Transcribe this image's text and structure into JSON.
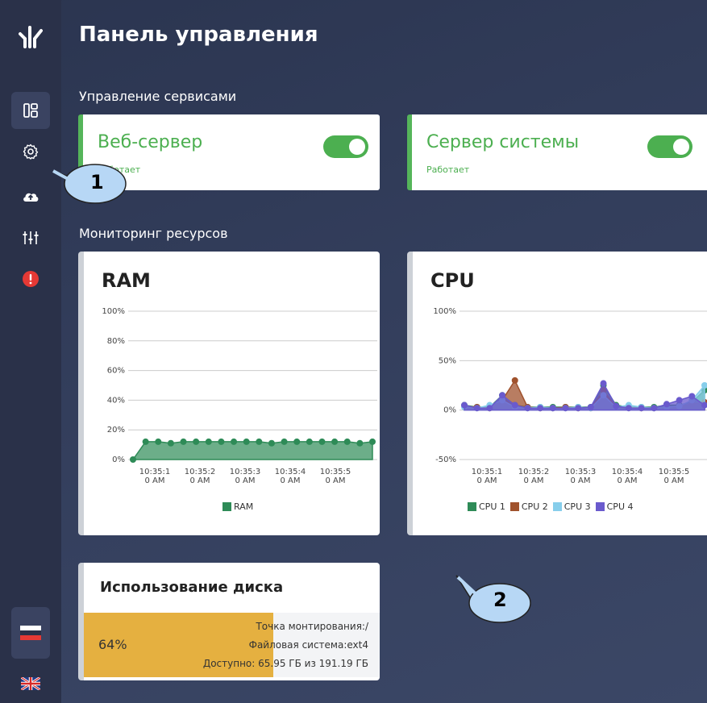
{
  "header": {
    "title": "Панель управления"
  },
  "sections": {
    "services": "Управление сервисами",
    "monitoring": "Мониторинг ресурсов"
  },
  "services": [
    {
      "name": "Веб-сервер",
      "status": "Работает",
      "enabled": true
    },
    {
      "name": "Сервер системы",
      "status": "Работает",
      "enabled": true
    }
  ],
  "sidebar": {
    "items": [
      {
        "icon": "dashboard-icon",
        "active": true
      },
      {
        "icon": "gear-icon",
        "active": false
      },
      {
        "icon": "cloud-upload-icon",
        "active": false
      },
      {
        "icon": "sliders-icon",
        "active": false
      },
      {
        "icon": "alert-icon",
        "active": false
      }
    ],
    "languages": [
      {
        "icon": "russian-flag-icon",
        "active": true
      },
      {
        "icon": "uk-flag-icon",
        "active": false
      }
    ]
  },
  "callouts": {
    "first": "1",
    "second": "2"
  },
  "colors": {
    "green": "#4caf50",
    "ram": "#2e8b57",
    "cpu1": "#2e8b57",
    "cpu2": "#a0522d",
    "cpu3": "#87ceeb",
    "cpu4": "#6a5acd",
    "disk": "#e5b040",
    "alert": "#e53935"
  },
  "chart_data": [
    {
      "type": "area",
      "title": "RAM",
      "x": [
        "10:35:1\n0 AM",
        "10:35:2\n0 AM",
        "10:35:3\n0 AM",
        "10:35:4\n0 AM",
        "10:35:5\n0 AM"
      ],
      "ylim": [
        0,
        100
      ],
      "y_ticks": [
        "0%",
        "20%",
        "40%",
        "60%",
        "80%",
        "100%"
      ],
      "series": [
        {
          "name": "RAM",
          "values": [
            0,
            12,
            12,
            11,
            12,
            12,
            12,
            12,
            12,
            12,
            12,
            11,
            12,
            12,
            12,
            12,
            12,
            12,
            11,
            12
          ]
        }
      ],
      "legend": "bottom"
    },
    {
      "type": "area",
      "title": "CPU",
      "x": [
        "10:35:1\n0 AM",
        "10:35:2\n0 AM",
        "10:35:3\n0 AM",
        "10:35:4\n0 AM",
        "10:35:5\n0 AM"
      ],
      "ylim": [
        -50,
        100
      ],
      "y_ticks": [
        "-50%",
        "0%",
        "50%",
        "100%"
      ],
      "series": [
        {
          "name": "CPU 1",
          "values": [
            5,
            3,
            3,
            15,
            5,
            3,
            3,
            3,
            3,
            3,
            3,
            25,
            5,
            3,
            3,
            3,
            5,
            5,
            8,
            20
          ]
        },
        {
          "name": "CPU 2",
          "values": [
            4,
            3,
            2,
            10,
            30,
            3,
            2,
            2,
            3,
            2,
            2,
            20,
            3,
            3,
            2,
            2,
            3,
            4,
            6,
            8
          ]
        },
        {
          "name": "CPU 3",
          "values": [
            3,
            2,
            5,
            10,
            3,
            2,
            3,
            2,
            2,
            3,
            2,
            15,
            3,
            5,
            3,
            2,
            3,
            4,
            10,
            25
          ]
        },
        {
          "name": "CPU 4",
          "values": [
            5,
            2,
            2,
            15,
            5,
            2,
            2,
            2,
            2,
            2,
            3,
            27,
            4,
            2,
            2,
            2,
            6,
            10,
            14,
            5
          ]
        }
      ],
      "legend": "bottom"
    }
  ],
  "disk": {
    "title": "Использование диска",
    "percent_label": "64%",
    "percent": 64,
    "mount": "Точка монтирования:/",
    "filesystem": "Файловая система:ext4",
    "available": "Доступно: 65.95 ГБ из 191.19 ГБ"
  }
}
